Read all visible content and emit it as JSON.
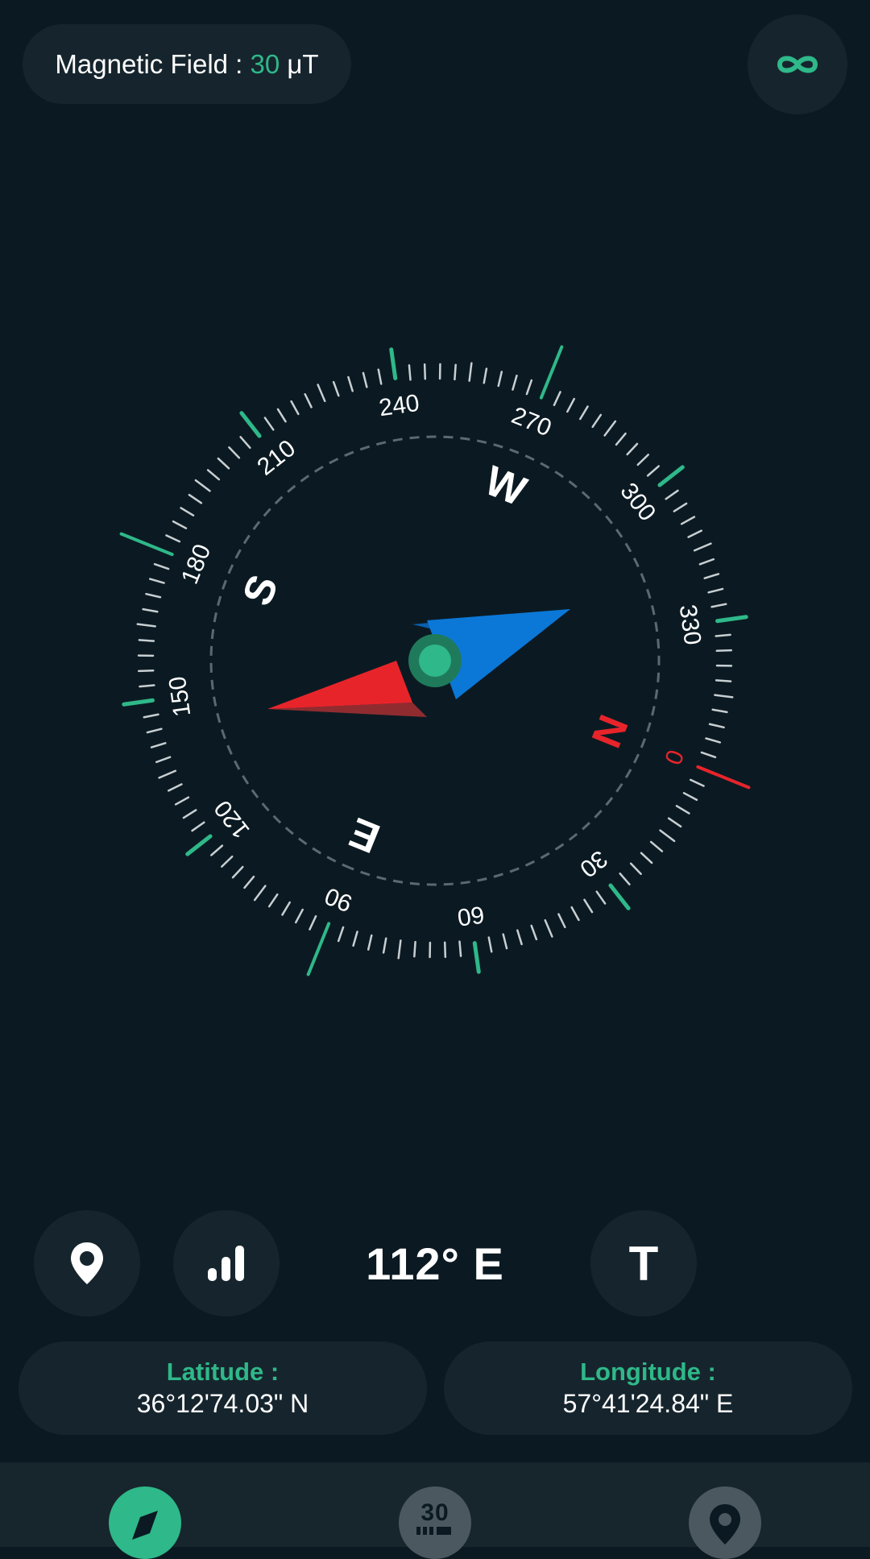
{
  "header": {
    "magnetic_label": "Magnetic Field : ",
    "magnetic_value": "30",
    "magnetic_unit": " μT",
    "infinity_icon": "infinity-icon"
  },
  "compass": {
    "heading_degrees": 112,
    "degree_labels": [
      "0",
      "30",
      "60",
      "90",
      "120",
      "150",
      "180",
      "210",
      "240",
      "270",
      "300",
      "330"
    ],
    "cardinals": [
      "N",
      "E",
      "S",
      "W"
    ]
  },
  "controls": {
    "location_icon": "location-pin-icon",
    "signal_icon": "signal-bars-icon",
    "heading_text": "112° E",
    "true_north_label": "T"
  },
  "coordinates": {
    "latitude_label": "Latitude :",
    "latitude_value": "36°12'74.03\" N",
    "longitude_label": "Longitude :",
    "longitude_value": "57°41'24.84\" E"
  },
  "nav": {
    "items": [
      {
        "icon": "compass-icon",
        "active": true
      },
      {
        "icon": "number-30-icon",
        "label": "30",
        "active": false
      },
      {
        "icon": "location-pin-icon",
        "active": false
      }
    ]
  },
  "colors": {
    "background": "#0b1a22",
    "pill": "#16252d",
    "accent_green": "#2fb889",
    "north_red": "#e8242b",
    "south_blue": "#0a72c8"
  }
}
